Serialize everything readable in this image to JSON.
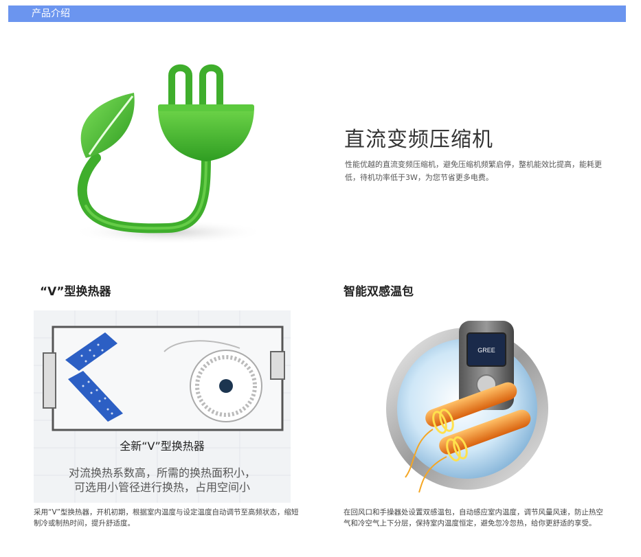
{
  "header": {
    "title": "产品介绍",
    "bar_color": "#6b95ef"
  },
  "hero": {
    "icon": "eco-plug-leaf-icon",
    "title": "直流变频压缩机",
    "description": "性能优越的直流变频压缩机，避免压缩机频繁启停，整机能效比提高，能耗更低，待机功率低于3W，为您节省更多电费。"
  },
  "feature_left": {
    "title": "“V”型换热器",
    "image": {
      "icon": "v-heat-exchanger-diagram",
      "caption_main": "全新“V”型换热器",
      "caption_line1": "对流换热系数高，所需的换热面积小，",
      "caption_line2": "可选用小管径进行换热，占用空间小"
    },
    "description": "采用“V”型换热器，开机初期，根据室内温度与设定温度自动调节至高频状态，缩短制冷或制热时间，提升舒适度。"
  },
  "feature_right": {
    "title": "智能双感温包",
    "image": {
      "icon": "dual-temperature-sensor-icon",
      "brand_text": "GREE"
    },
    "description": "在回风口和手操器处设置双感温包，自动感应室内温度，调节风量风速，防止热空气和冷空气上下分层，保持室内温度恒定，避免忽冷忽热，给你更舒适的享受。"
  },
  "colors": {
    "leaf_green": "#4cc43a",
    "dark_green": "#2e9a22",
    "coil_blue": "#2c5fc4",
    "tube_orange": "#f08a1e"
  }
}
